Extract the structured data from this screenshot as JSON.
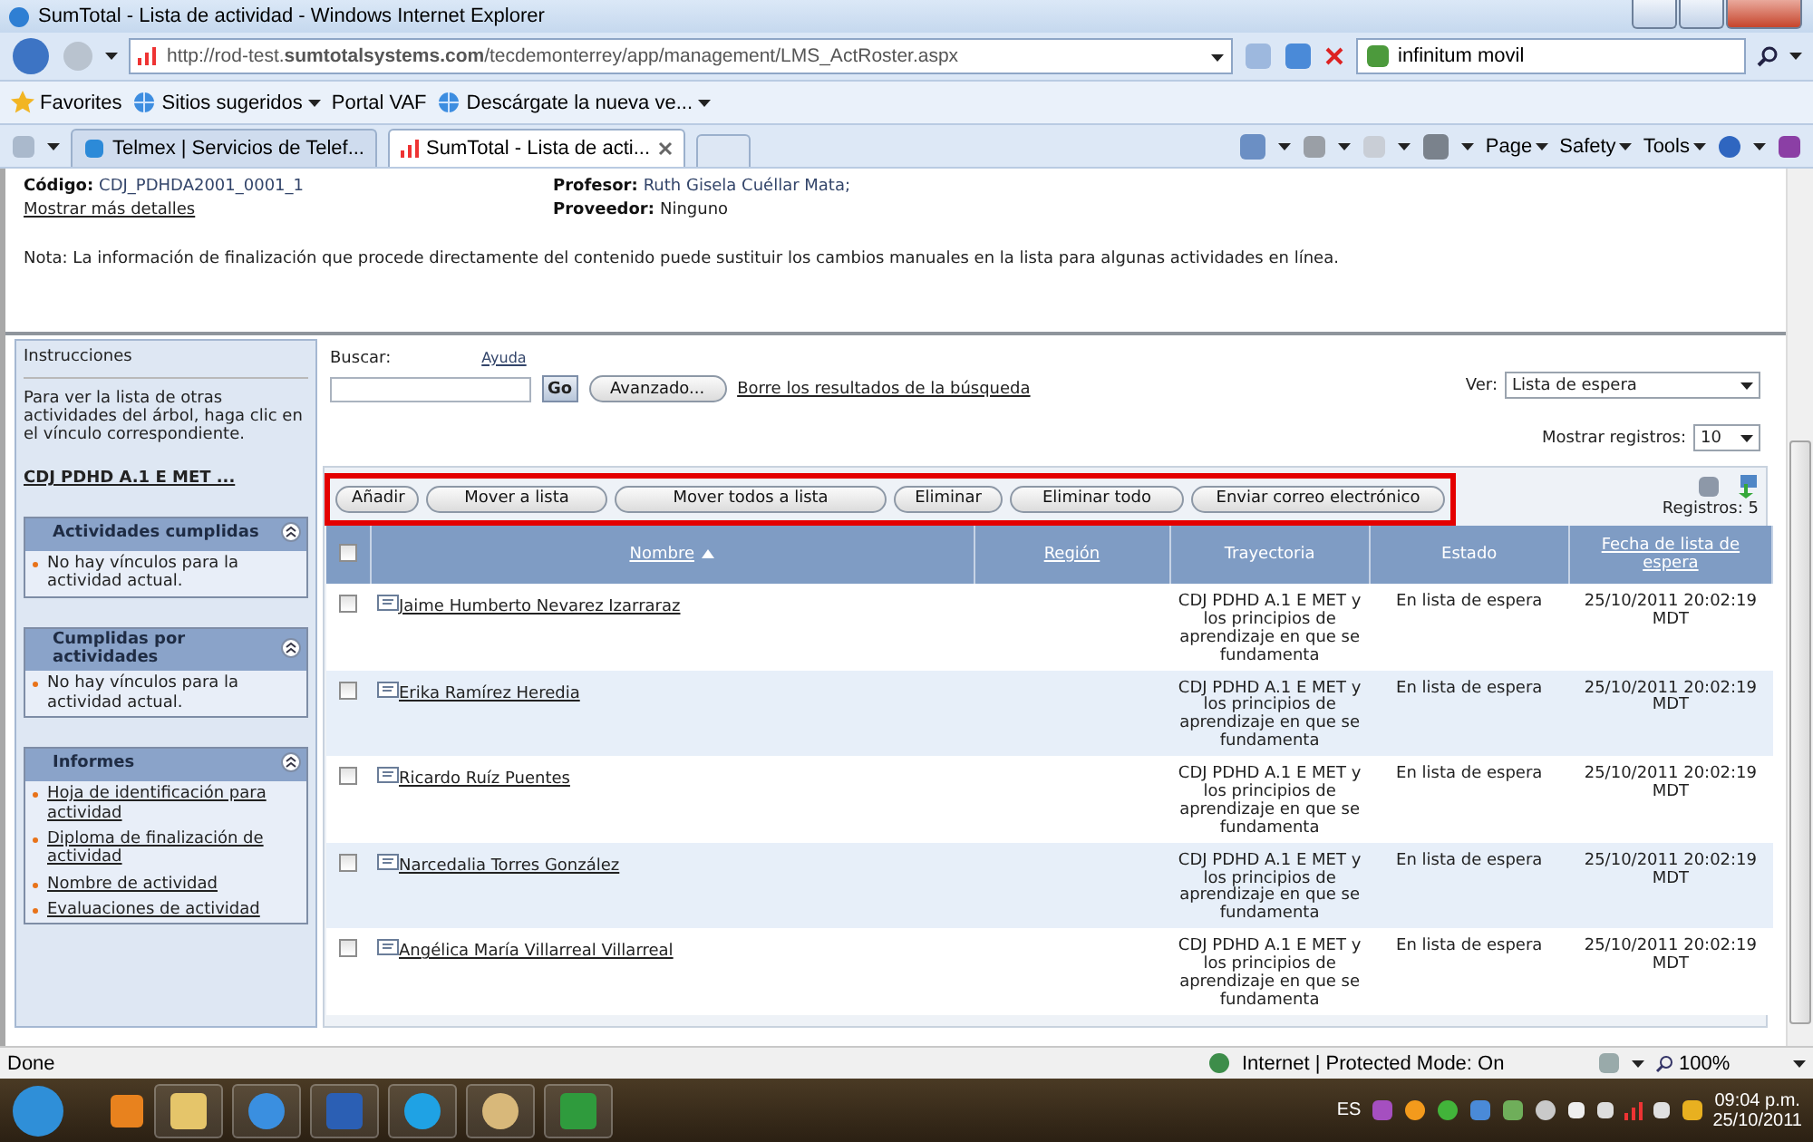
{
  "window": {
    "title": "SumTotal - Lista de actividad - Windows Internet Explorer"
  },
  "address_bar": {
    "url": "http://rod-test.**sumtotalsystems.com**/tecdemonterrey/app/management/LMS_ActRoster.aspx"
  },
  "search_box": {
    "value": "infinitum movil"
  },
  "favorites_bar": {
    "items": [
      {
        "label": "Favorites",
        "kind": "star"
      },
      {
        "label": "Sitios sugeridos",
        "kind": "menu"
      },
      {
        "label": "Portal VAF",
        "kind": "plain"
      },
      {
        "label": "Descárgate la nueva ve...",
        "kind": "menu"
      }
    ]
  },
  "tabs": [
    {
      "label": "Telmex | Servicios de Telef...",
      "selected": false
    },
    {
      "label": "SumTotal - Lista de acti...",
      "selected": true
    }
  ],
  "command_bar": [
    "Page",
    "Safety",
    "Tools"
  ],
  "header": {
    "code_label": "Código:",
    "code": "CDJ_PDHDA2001_0001_1",
    "details_link": "Mostrar más detalles",
    "teacher_label": "Profesor:",
    "teacher": "Ruth Gisela Cuéllar Mata;",
    "provider_label": "Proveedor:",
    "provider": "Ninguno",
    "note": "Nota: La información de finalización que procede directamente del contenido puede sustituir los cambios manuales en la lista para algunas actividades en línea."
  },
  "sidebar": {
    "title": "Instrucciones",
    "text": "Para ver la lista de otras actividades del árbol, haga clic en el vínculo correspondiente.",
    "tree_link": "CDJ PDHD A.1 E MET ...",
    "panels": [
      {
        "title": "Actividades cumplidas",
        "expanded": true,
        "items": [
          {
            "text": "No hay vínculos para la actividad actual.",
            "link": false
          }
        ]
      },
      {
        "title": "Cumplidas por actividades",
        "expanded": true,
        "items": [
          {
            "text": "No hay vínculos para la actividad actual.",
            "link": false
          }
        ]
      },
      {
        "title": "Informes",
        "expanded": true,
        "items": [
          {
            "text": "Hoja de identificación para actividad",
            "link": true
          },
          {
            "text": "Diploma de finalización de actividad",
            "link": true
          },
          {
            "text": "Nombre de actividad",
            "link": true
          },
          {
            "text": "Evaluaciones de actividad",
            "link": true
          }
        ]
      }
    ]
  },
  "search": {
    "label": "Buscar:",
    "help": "Ayuda",
    "go": "Go",
    "advanced": "Avanzado...",
    "clear": "Borre los resultados de la búsqueda"
  },
  "view": {
    "label": "Ver:",
    "value": "Lista de espera"
  },
  "page_size": {
    "label": "Mostrar registros:",
    "value": "10"
  },
  "actions": {
    "highlighted": true,
    "buttons": [
      "Añadir",
      "Mover a lista",
      "Mover todos a lista",
      "Eliminar",
      "Eliminar todo",
      "Enviar correo electrónico"
    ]
  },
  "records": "Registros: 5",
  "table": {
    "select_all": {
      "checked": false
    },
    "columns": [
      {
        "label": "Nombre",
        "link": true,
        "sorted": true
      },
      {
        "label": "Región",
        "link": true,
        "sorted": false
      },
      {
        "label": "Trayectoria",
        "link": false,
        "sorted": false
      },
      {
        "label": "Estado",
        "link": false,
        "sorted": false
      },
      {
        "label": "Fecha de lista de espera",
        "link": true,
        "sorted": false
      }
    ],
    "rows": [
      {
        "checked": false,
        "name": "Jaime Humberto Nevarez Izarraraz",
        "path": "CDJ PDHD A.1 E MET y los principios de aprendizaje en que se fundamenta",
        "status": "En lista de espera",
        "date": "25/10/2011 20:02:19 MDT"
      },
      {
        "checked": false,
        "name": "Erika Ramírez Heredia",
        "path": "CDJ PDHD A.1 E MET y los principios de aprendizaje en que se fundamenta",
        "status": "En lista de espera",
        "date": "25/10/2011 20:02:19 MDT"
      },
      {
        "checked": false,
        "name": "Ricardo Ruíz Puentes",
        "path": "CDJ PDHD A.1 E MET y los principios de aprendizaje en que se fundamenta",
        "status": "En lista de espera",
        "date": "25/10/2011 20:02:19 MDT"
      },
      {
        "checked": false,
        "name": "Narcedalia Torres González",
        "path": "CDJ PDHD A.1 E MET y los principios de aprendizaje en que se fundamenta",
        "status": "En lista de espera",
        "date": "25/10/2011 20:02:19 MDT"
      },
      {
        "checked": false,
        "name": "Angélica María Villarreal Villarreal",
        "path": "CDJ PDHD A.1 E MET y los principios de aprendizaje en que se fundamenta",
        "status": "En lista de espera",
        "date": "25/10/2011 20:02:19 MDT"
      }
    ]
  },
  "status_bar": {
    "text": "Done",
    "zone": "Internet | Protected Mode: On",
    "zoom": "100%"
  },
  "taskbar": {
    "language": "ES",
    "time": "09:04 p.m.",
    "date": "25/10/2011"
  }
}
